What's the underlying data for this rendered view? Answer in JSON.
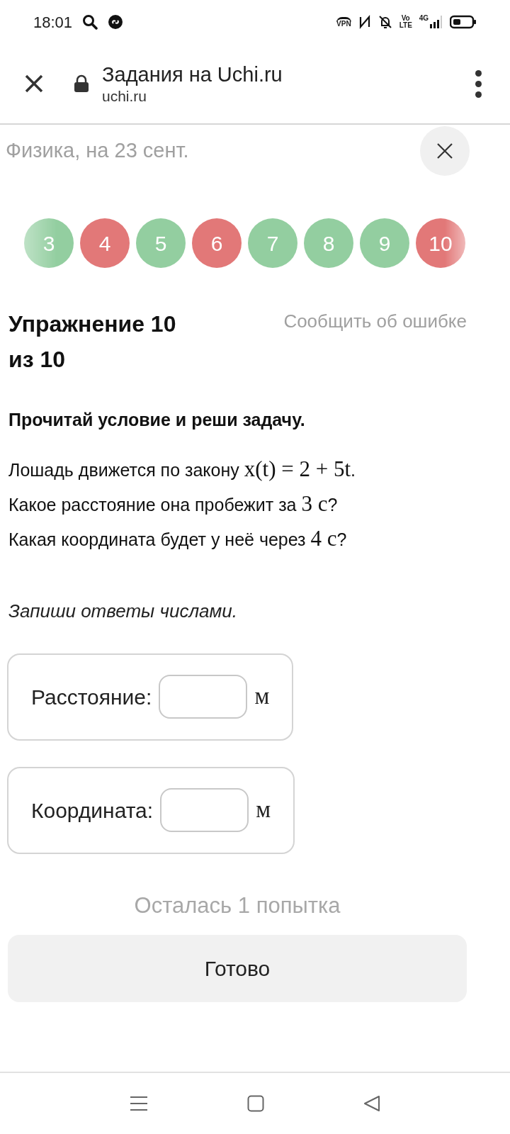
{
  "status_bar": {
    "time": "18:01",
    "icons_text": [
      "VPN",
      "Vo LTE",
      "4G"
    ]
  },
  "browser": {
    "title": "Задания на Uchi.ru",
    "url": "uchi.ru"
  },
  "lesson": {
    "title": "Физика, на 23 сент."
  },
  "exercises": [
    {
      "label": "3",
      "color": "#93cea0"
    },
    {
      "label": "4",
      "color": "#e27878"
    },
    {
      "label": "5",
      "color": "#93cea0"
    },
    {
      "label": "6",
      "color": "#e27878"
    },
    {
      "label": "7",
      "color": "#93cea0"
    },
    {
      "label": "8",
      "color": "#93cea0"
    },
    {
      "label": "9",
      "color": "#93cea0"
    },
    {
      "label": "10",
      "color": "#e27878"
    }
  ],
  "heading": "Упражнение 10 из 10",
  "report_link": "Сообщить об ошибке",
  "instruction": "Прочитай условие и реши задачу.",
  "problem": [
    [
      {
        "kind": "text",
        "text": "Лошадь движется по закону "
      },
      {
        "kind": "math",
        "text": "x(t) = 2 + 5t"
      },
      {
        "kind": "text",
        "text": "."
      }
    ],
    [
      {
        "kind": "text",
        "text": "Какое расстояние она пробежит за "
      },
      {
        "kind": "math",
        "text": "3 с"
      },
      {
        "kind": "text",
        "text": "?"
      }
    ],
    [
      {
        "kind": "text",
        "text": "Какая координата будет у неё через "
      },
      {
        "kind": "math",
        "text": "4 с"
      },
      {
        "kind": "text",
        "text": "?"
      }
    ]
  ],
  "hint": "Запиши ответы числами.",
  "answers": [
    {
      "label": "Расстояние:",
      "unit": "м"
    },
    {
      "label": "Координата:",
      "unit": "м"
    }
  ],
  "attempts": "Осталась 1 попытка",
  "submit": "Готово"
}
